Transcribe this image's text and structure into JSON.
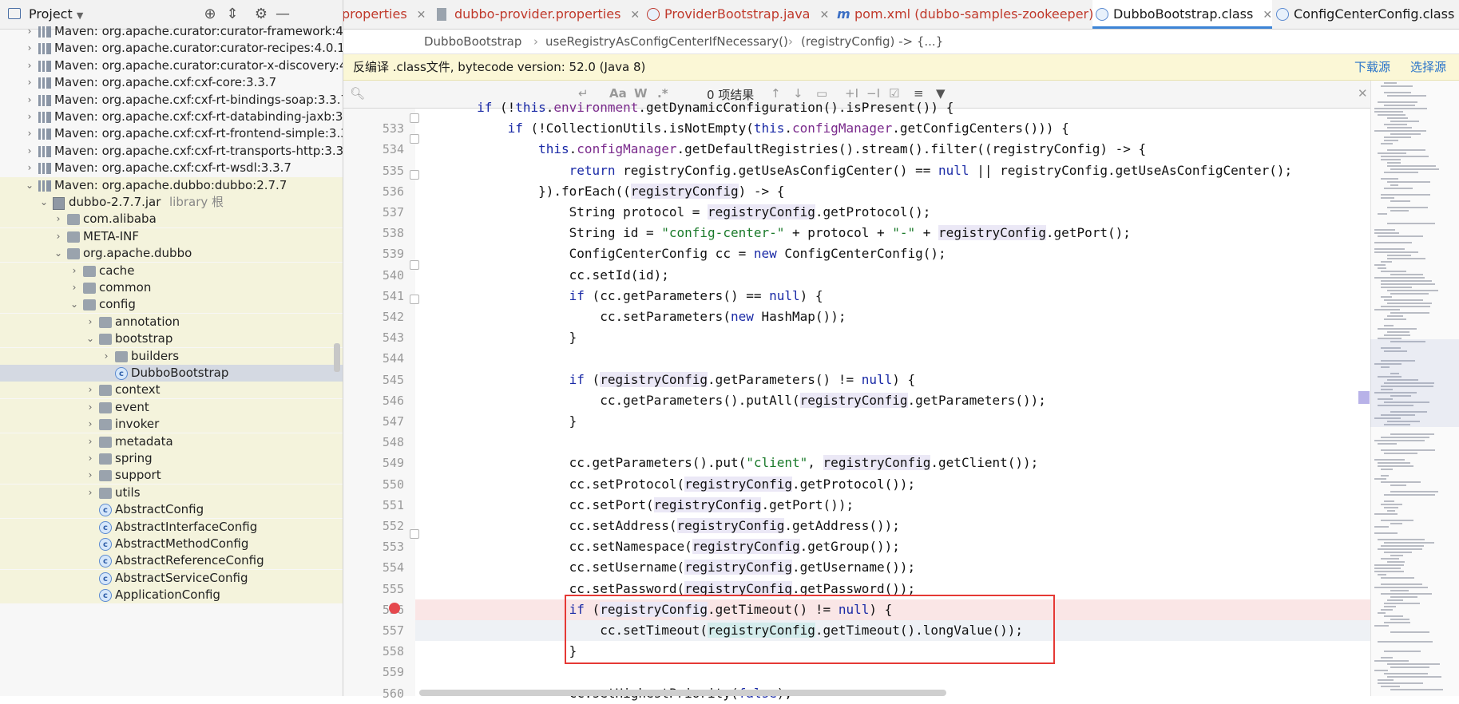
{
  "project": {
    "title": "Project",
    "tree": [
      {
        "label": "Maven: org.apache.curator:curator-framework:4.",
        "type": "lib",
        "depth": 0,
        "arrow": "right",
        "hl": false
      },
      {
        "label": "Maven: org.apache.curator:curator-recipes:4.0.1",
        "type": "lib",
        "depth": 0,
        "arrow": "right",
        "hl": false
      },
      {
        "label": "Maven: org.apache.curator:curator-x-discovery:4",
        "type": "lib",
        "depth": 0,
        "arrow": "right",
        "hl": false
      },
      {
        "label": "Maven: org.apache.cxf:cxf-core:3.3.7",
        "type": "lib",
        "depth": 0,
        "arrow": "right",
        "hl": false
      },
      {
        "label": "Maven: org.apache.cxf:cxf-rt-bindings-soap:3.3.7",
        "type": "lib",
        "depth": 0,
        "arrow": "right",
        "hl": false
      },
      {
        "label": "Maven: org.apache.cxf:cxf-rt-databinding-jaxb:3.",
        "type": "lib",
        "depth": 0,
        "arrow": "right",
        "hl": false
      },
      {
        "label": "Maven: org.apache.cxf:cxf-rt-frontend-simple:3.3",
        "type": "lib",
        "depth": 0,
        "arrow": "right",
        "hl": false
      },
      {
        "label": "Maven: org.apache.cxf:cxf-rt-transports-http:3.3",
        "type": "lib",
        "depth": 0,
        "arrow": "right",
        "hl": false
      },
      {
        "label": "Maven: org.apache.cxf:cxf-rt-wsdl:3.3.7",
        "type": "lib",
        "depth": 0,
        "arrow": "right",
        "hl": false
      },
      {
        "label": "Maven: org.apache.dubbo:dubbo:2.7.7",
        "type": "lib",
        "depth": 0,
        "arrow": "down",
        "hl": true
      },
      {
        "label": "dubbo-2.7.7.jar",
        "suffix": "library 根",
        "type": "jar",
        "depth": 1,
        "arrow": "down",
        "hl": true
      },
      {
        "label": "com.alibaba",
        "type": "folder",
        "depth": 2,
        "arrow": "right",
        "hl": true
      },
      {
        "label": "META-INF",
        "type": "folder",
        "depth": 2,
        "arrow": "right",
        "hl": true
      },
      {
        "label": "org.apache.dubbo",
        "type": "folder",
        "depth": 2,
        "arrow": "down",
        "hl": true
      },
      {
        "label": "cache",
        "type": "folder",
        "depth": 3,
        "arrow": "right",
        "hl": true
      },
      {
        "label": "common",
        "type": "folder",
        "depth": 3,
        "arrow": "right",
        "hl": true
      },
      {
        "label": "config",
        "type": "folder",
        "depth": 3,
        "arrow": "down",
        "hl": true
      },
      {
        "label": "annotation",
        "type": "folder",
        "depth": 4,
        "arrow": "right",
        "hl": true
      },
      {
        "label": "bootstrap",
        "type": "folder",
        "depth": 4,
        "arrow": "down",
        "hl": true
      },
      {
        "label": "builders",
        "type": "folder",
        "depth": 5,
        "arrow": "right",
        "hl": true
      },
      {
        "label": "DubboBootstrap",
        "type": "class",
        "depth": 5,
        "arrow": "",
        "hl": false,
        "sel": true
      },
      {
        "label": "context",
        "type": "folder",
        "depth": 4,
        "arrow": "right",
        "hl": true
      },
      {
        "label": "event",
        "type": "folder",
        "depth": 4,
        "arrow": "right",
        "hl": true
      },
      {
        "label": "invoker",
        "type": "folder",
        "depth": 4,
        "arrow": "right",
        "hl": true
      },
      {
        "label": "metadata",
        "type": "folder",
        "depth": 4,
        "arrow": "right",
        "hl": true
      },
      {
        "label": "spring",
        "type": "folder",
        "depth": 4,
        "arrow": "right",
        "hl": true
      },
      {
        "label": "support",
        "type": "folder",
        "depth": 4,
        "arrow": "right",
        "hl": true
      },
      {
        "label": "utils",
        "type": "folder",
        "depth": 4,
        "arrow": "right",
        "hl": true
      },
      {
        "label": "AbstractConfig",
        "type": "class",
        "depth": 4,
        "arrow": "",
        "hl": true
      },
      {
        "label": "AbstractInterfaceConfig",
        "type": "class",
        "depth": 4,
        "arrow": "",
        "hl": true
      },
      {
        "label": "AbstractMethodConfig",
        "type": "class",
        "depth": 4,
        "arrow": "",
        "hl": true
      },
      {
        "label": "AbstractReferenceConfig",
        "type": "class",
        "depth": 4,
        "arrow": "",
        "hl": true
      },
      {
        "label": "AbstractServiceConfig",
        "type": "class",
        "depth": 4,
        "arrow": "",
        "hl": true
      },
      {
        "label": "ApplicationConfig",
        "type": "class",
        "depth": 4,
        "arrow": "",
        "hl": true
      }
    ]
  },
  "tabs": [
    {
      "label": "properties",
      "icon": "none",
      "red": true,
      "active": false,
      "close": true
    },
    {
      "label": "dubbo-provider.properties",
      "icon": "properties-icon",
      "red": true,
      "active": false,
      "close": true
    },
    {
      "label": "ProviderBootstrap.java",
      "icon": "java-class-icon",
      "red": true,
      "active": false,
      "close": true
    },
    {
      "label": "pom.xml (dubbo-samples-zookeeper)",
      "icon": "maven-icon",
      "red": true,
      "active": false,
      "close": true
    },
    {
      "label": "DubboBootstrap.class",
      "icon": "class-icon",
      "red": false,
      "active": true,
      "close": true
    },
    {
      "label": "ConfigCenterConfig.class",
      "icon": "class-icon",
      "red": false,
      "active": false,
      "close": false
    }
  ],
  "breadcrumb": [
    "DubboBootstrap",
    "useRegistryAsConfigCenterIfNecessary()",
    "(registryConfig) -> {...}"
  ],
  "notice": {
    "text": "反编译 .class文件, bytecode version: 52.0 (Java 8)",
    "download_label": "下载源",
    "choose_label": "选择源 (S"
  },
  "find": {
    "value": "",
    "match_case": "Aa",
    "words": "W",
    "regex": ".*",
    "results": "0 项结果"
  },
  "code": {
    "lines": [
      {
        "n": "",
        "html": "        <span class='kw'>if</span> (!<span class='kw'>this</span>.<span class='fld'>environment</span>.getDynamicConfiguration().isPresent()) {"
      },
      {
        "n": "533",
        "html": "            <span class='kw'>if</span> (!CollectionUtils.isNotEmpty(<span class='kw'>this</span>.<span class='fld'>configManager</span>.getConfigCenters())) {"
      },
      {
        "n": "534",
        "html": "                <span class='kw'>this</span>.<span class='fld'>configManager</span>.getDefaultRegistries().stream().filter((registryConfig) -> {"
      },
      {
        "n": "535",
        "html": "                    <span class='kw'>return</span> registryConfig.getUseAsConfigCenter() == <span class='kw'>null</span> || registryConfig.getUseAsConfigCenter();"
      },
      {
        "n": "536",
        "html": "                }).forEach((<span class='hlv'>registryConfig</span>) -> {"
      },
      {
        "n": "537",
        "html": "                    String protocol = <span class='hlv'>registryConfig</span>.getProtocol();"
      },
      {
        "n": "538",
        "html": "                    String id = <span class='str'>\"config-center-\"</span> + protocol + <span class='str'>\"-\"</span> + <span class='hlv'>registryConfig</span>.getPort();"
      },
      {
        "n": "539",
        "html": "                    ConfigCenterConfig cc = <span class='kw'>new</span> ConfigCenterConfig();"
      },
      {
        "n": "540",
        "html": "                    cc.setId(id);"
      },
      {
        "n": "541",
        "html": "                    <span class='kw'>if</span> (cc.getParameters() == <span class='kw'>null</span>) {"
      },
      {
        "n": "542",
        "html": "                        cc.setParameters(<span class='kw'>new</span> HashMap());"
      },
      {
        "n": "543",
        "html": "                    }"
      },
      {
        "n": "544",
        "html": ""
      },
      {
        "n": "545",
        "html": "                    <span class='kw'>if</span> (<span class='hlv'>registryConfig</span>.getParameters() != <span class='kw'>null</span>) {"
      },
      {
        "n": "546",
        "html": "                        cc.getParameters().putAll(<span class='hlv'>registryConfig</span>.getParameters());"
      },
      {
        "n": "547",
        "html": "                    }"
      },
      {
        "n": "548",
        "html": ""
      },
      {
        "n": "549",
        "html": "                    cc.getParameters().put(<span class='str'>\"client\"</span>, <span class='hlv'>registryConfig</span>.getClient());"
      },
      {
        "n": "550",
        "html": "                    cc.setProtocol(<span class='hlv'>registryConfig</span>.getProtocol());"
      },
      {
        "n": "551",
        "html": "                    cc.setPort(<span class='hlv'>registryConfig</span>.getPort());"
      },
      {
        "n": "552",
        "html": "                    cc.setAddress(<span class='hlv'>registryConfig</span>.getAddress());"
      },
      {
        "n": "553",
        "html": "                    cc.setNamespace(<span class='hlv'>registryConfig</span>.getGroup());"
      },
      {
        "n": "554",
        "html": "                    cc.setUsername(<span class='hlv'>registryConfig</span>.getUsername());"
      },
      {
        "n": "555",
        "html": "                    cc.setPassword(<span class='hlv'>registryConfig</span>.getPassword());"
      },
      {
        "n": "556",
        "html": "                    <span class='kw'>if</span> (<span class='hlv'>registryConfig</span>.getTimeout() != <span class='kw'>null</span>) {",
        "bp": true
      },
      {
        "n": "557",
        "html": "                        cc.setTimeout(<span class='hlv2'>registryConfig</span>.getTimeout().longValue());",
        "cur": true
      },
      {
        "n": "558",
        "html": "                    }"
      },
      {
        "n": "559",
        "html": ""
      },
      {
        "n": "560",
        "html": "                    cc.setHighestPriority(<span class='kw'>false</span>);"
      }
    ]
  },
  "colors": {
    "accent": "#3c84d6",
    "breakpoint": "#e5484d",
    "annotation_box": "#e53935",
    "notice_bg": "#fbf7d6"
  }
}
